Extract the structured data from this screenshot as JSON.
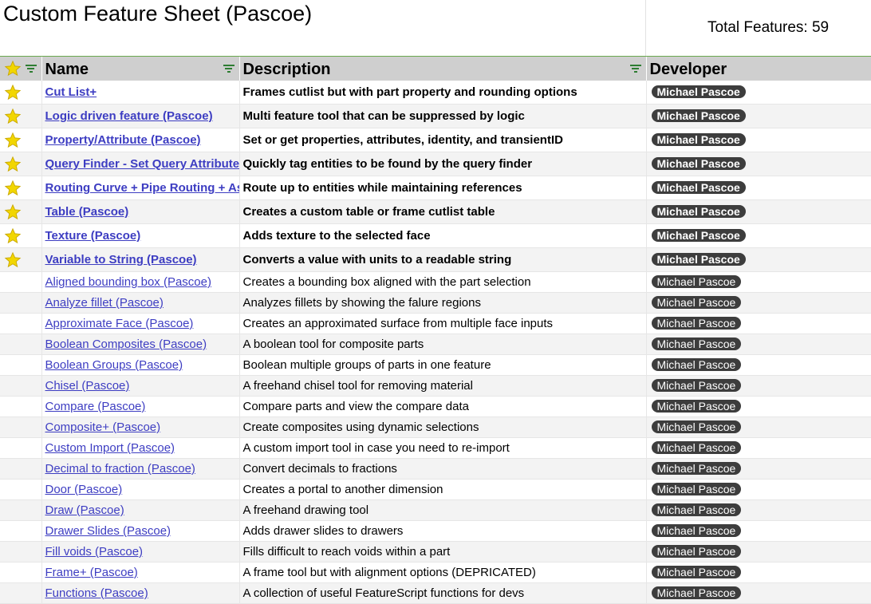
{
  "sheet": {
    "title": "Custom Feature Sheet (Pascoe)",
    "total_label": "Total Features: 59"
  },
  "columns": {
    "name": "Name",
    "description": "Description",
    "developer": "Developer"
  },
  "colors": {
    "header_bg": "#cfcfcf",
    "link": "#3d3dc2",
    "pill_bg": "#3d3d3d",
    "star": "#f2d600",
    "filter_icon": "#2e7d32"
  },
  "rows": [
    {
      "starred": true,
      "name": "Cut List+",
      "description": "Frames cutlist but with part property and rounding options",
      "developer": "Michael Pascoe"
    },
    {
      "starred": true,
      "name": "Logic driven feature (Pascoe)",
      "description": "Multi feature tool that can be suppressed by logic",
      "developer": "Michael Pascoe"
    },
    {
      "starred": true,
      "name": "Property/Attribute (Pascoe)",
      "description": "Set or get properties, attributes, identity, and transientID",
      "developer": "Michael Pascoe"
    },
    {
      "starred": true,
      "name": "Query Finder - Set Query Attribute",
      "description": "Quickly tag entities to be found by the query finder",
      "developer": "Michael Pascoe"
    },
    {
      "starred": true,
      "name": "Routing Curve + Pipe Routing + As",
      "description": "Route up to entities while maintaining references",
      "developer": "Michael Pascoe"
    },
    {
      "starred": true,
      "name": "Table (Pascoe)",
      "description": "Creates a custom table or frame cutlist table",
      "developer": "Michael Pascoe"
    },
    {
      "starred": true,
      "name": "Texture (Pascoe)",
      "description": "Adds texture to the selected face",
      "developer": "Michael Pascoe"
    },
    {
      "starred": true,
      "name": "Variable to String (Pascoe)",
      "description": "Converts a value with units to a readable string",
      "developer": "Michael Pascoe"
    },
    {
      "starred": false,
      "name": "Aligned bounding box (Pascoe)",
      "description": "Creates a bounding box aligned with the part selection",
      "developer": "Michael Pascoe"
    },
    {
      "starred": false,
      "name": "Analyze fillet (Pascoe)",
      "description": "Analyzes fillets by showing the falure regions",
      "developer": "Michael Pascoe"
    },
    {
      "starred": false,
      "name": "Approximate Face (Pascoe)",
      "description": "Creates an approximated surface from multiple face inputs",
      "developer": "Michael Pascoe"
    },
    {
      "starred": false,
      "name": "Boolean Composites (Pascoe)",
      "description": "A boolean tool for composite parts",
      "developer": "Michael Pascoe"
    },
    {
      "starred": false,
      "name": "Boolean Groups (Pascoe)",
      "description": "Boolean multiple groups of parts in one feature",
      "developer": "Michael Pascoe"
    },
    {
      "starred": false,
      "name": "Chisel (Pascoe)",
      "description": "A freehand chisel tool for removing material",
      "developer": "Michael Pascoe"
    },
    {
      "starred": false,
      "name": "Compare (Pascoe)",
      "description": "Compare parts and view the compare data",
      "developer": "Michael Pascoe"
    },
    {
      "starred": false,
      "name": "Composite+ (Pascoe)",
      "description": "Create composites using dynamic selections",
      "developer": "Michael Pascoe"
    },
    {
      "starred": false,
      "name": "Custom Import (Pascoe)",
      "description": "A custom import tool in case you need to re-import",
      "developer": "Michael Pascoe"
    },
    {
      "starred": false,
      "name": "Decimal to fraction (Pascoe)",
      "description": "Convert decimals to fractions",
      "developer": "Michael Pascoe"
    },
    {
      "starred": false,
      "name": "Door (Pascoe)",
      "description": "Creates a portal to another dimension",
      "developer": "Michael Pascoe"
    },
    {
      "starred": false,
      "name": "Draw (Pascoe)",
      "description": "A freehand drawing tool",
      "developer": "Michael Pascoe"
    },
    {
      "starred": false,
      "name": "Drawer Slides (Pascoe)",
      "description": "Adds drawer slides to drawers",
      "developer": "Michael Pascoe"
    },
    {
      "starred": false,
      "name": "Fill voids (Pascoe)",
      "description": "Fills difficult to reach voids within a part",
      "developer": "Michael Pascoe"
    },
    {
      "starred": false,
      "name": "Frame+ (Pascoe)",
      "description": "A frame tool but with alignment options (DEPRICATED)",
      "developer": "Michael Pascoe"
    },
    {
      "starred": false,
      "name": "Functions (Pascoe)",
      "description": "A collection of useful FeatureScript functions for devs",
      "developer": "Michael Pascoe"
    }
  ]
}
